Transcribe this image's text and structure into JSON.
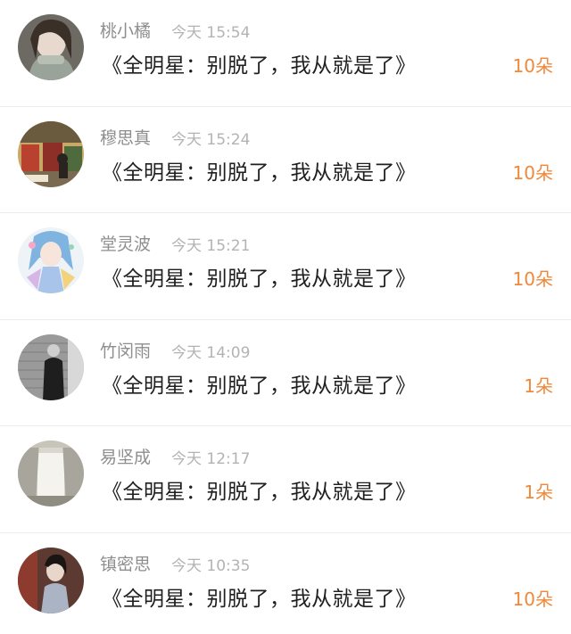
{
  "colors": {
    "name_text": "#8e8e8e",
    "time_text": "#b3b3b3",
    "message_text": "#1f1f1f",
    "count_accent": "#f0883a",
    "divider": "#ececec"
  },
  "records": [
    {
      "name": "桃小橘",
      "time": "今天 15:54",
      "gift": "《全明星：别脱了，我从就是了》",
      "count": "10朵",
      "avatar_icon": "avatar-girl-scarf-icon"
    },
    {
      "name": "穆思真",
      "time": "今天 15:24",
      "gift": "《全明星：别脱了，我从就是了》",
      "count": "10朵",
      "avatar_icon": "avatar-shop-street-icon"
    },
    {
      "name": "堂灵波",
      "time": "今天 15:21",
      "gift": "《全明星：别脱了，我从就是了》",
      "count": "10朵",
      "avatar_icon": "avatar-anime-girl-icon"
    },
    {
      "name": "竹闵雨",
      "time": "今天 14:09",
      "gift": "《全明星：别脱了，我从就是了》",
      "count": "1朵",
      "avatar_icon": "avatar-man-brick-wall-icon"
    },
    {
      "name": "易坚成",
      "time": "今天 12:17",
      "gift": "《全明星：别脱了，我从就是了》",
      "count": "1朵",
      "avatar_icon": "avatar-window-curtain-icon"
    },
    {
      "name": "镇密思",
      "time": "今天 10:35",
      "gift": "《全明星：别脱了，我从就是了》",
      "count": "10朵",
      "avatar_icon": "avatar-woman-portrait-icon"
    }
  ]
}
